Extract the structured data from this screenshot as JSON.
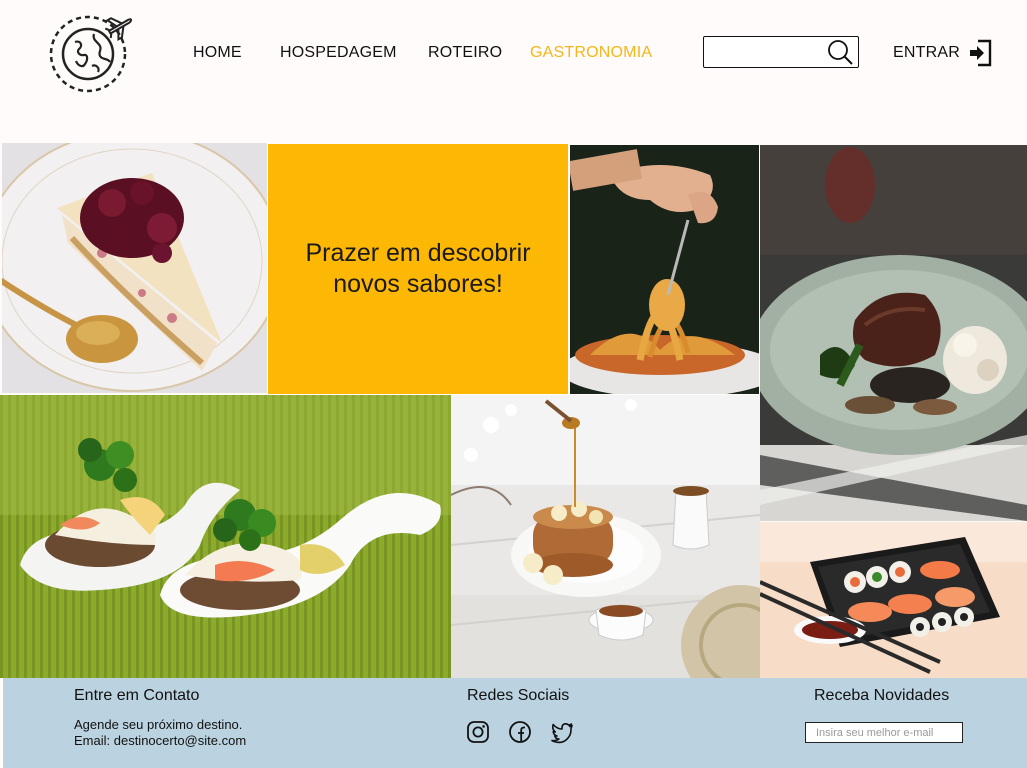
{
  "header": {
    "nav": [
      {
        "label": "HOME"
      },
      {
        "label": "HOSPEDAGEM"
      },
      {
        "label": "ROTEIRO"
      },
      {
        "label": "GASTRONOMIA"
      }
    ],
    "search": {
      "placeholder": ""
    },
    "login_label": "ENTRAR"
  },
  "feature": {
    "line1": "Prazer em descobrir",
    "line2": "novos sabores!"
  },
  "footer": {
    "contact": {
      "title": "Entre em Contato",
      "line1": "Agende seu próximo destino.",
      "line2": "Email: destinocerto@site.com"
    },
    "social": {
      "title": "Redes Sociais",
      "icons": [
        "instagram-icon",
        "facebook-icon",
        "twitter-icon"
      ]
    },
    "newsletter": {
      "title": "Receba Novidades",
      "placeholder": "Insira seu melhor e-mail"
    }
  },
  "colors": {
    "accent": "#fdb705",
    "nav_active": "#f3b71b",
    "footer_bg": "#bbd3e0",
    "header_bg": "#fffbfa"
  }
}
